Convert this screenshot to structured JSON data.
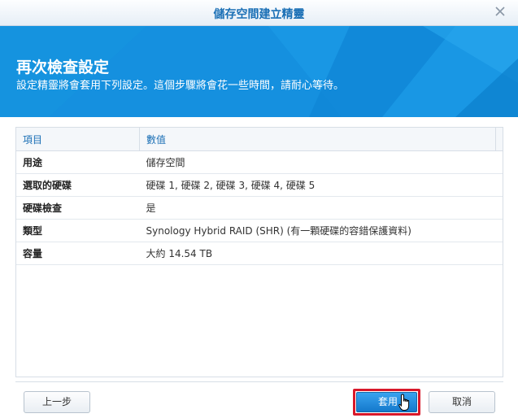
{
  "window": {
    "title": "儲存空間建立精靈"
  },
  "banner": {
    "heading": "再次檢查設定",
    "subheading": "設定精靈將會套用下列設定。這個步驟將會花一些時間，請耐心等待。"
  },
  "table": {
    "headers": [
      "項目",
      "數值"
    ],
    "rows": [
      {
        "key": "用途",
        "value": "儲存空間"
      },
      {
        "key": "選取的硬碟",
        "value": "硬碟 1, 硬碟 2, 硬碟 3, 硬碟 4, 硬碟 5"
      },
      {
        "key": "硬碟檢查",
        "value": "是"
      },
      {
        "key": "類型",
        "value": "Synology Hybrid RAID (SHR) (有一顆硬碟的容錯保護資料)"
      },
      {
        "key": "容量",
        "value": "大約 14.54 TB"
      }
    ]
  },
  "buttons": {
    "previous": "上一步",
    "apply": "套用",
    "cancel": "取消"
  },
  "colors": {
    "accent": "#1a6fb5",
    "banner": "#1590df",
    "highlight": "#d8182a"
  }
}
